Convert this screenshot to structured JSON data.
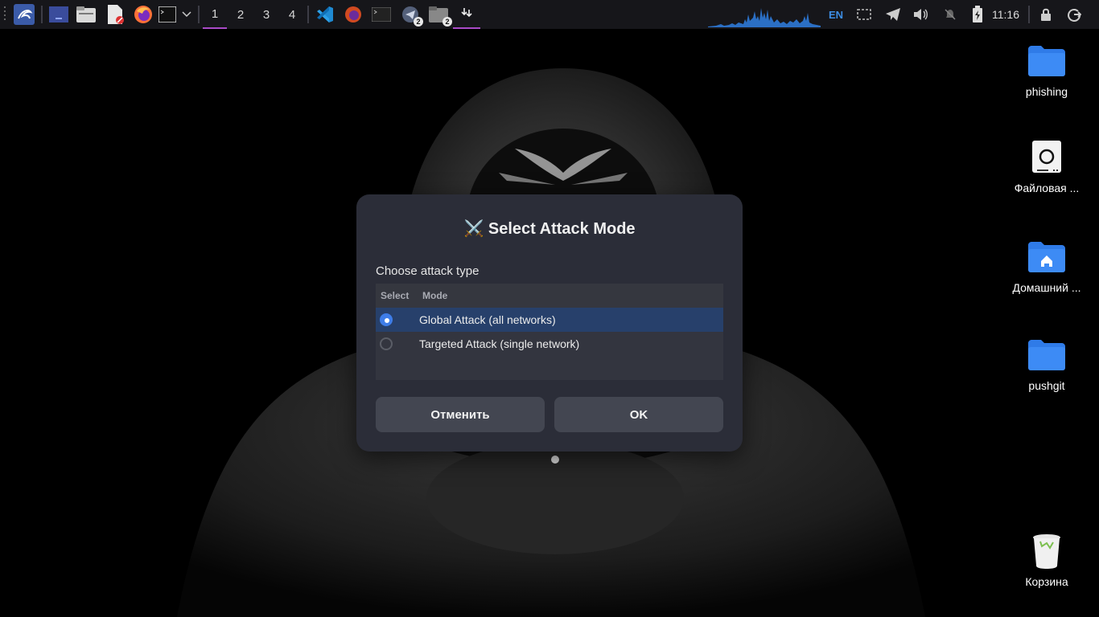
{
  "taskbar": {
    "workspaces": [
      "1",
      "2",
      "3",
      "4"
    ],
    "active_workspace": "1",
    "telegram_badge": "2",
    "files_badge": "2",
    "keyboard_layout": "EN",
    "clock": "11:16"
  },
  "desktop_icons": [
    {
      "label": "phishing",
      "icon": "folder-icon"
    },
    {
      "label": "Файловая ...",
      "icon": "drive-icon"
    },
    {
      "label": "Домашний ...",
      "icon": "home-folder-icon"
    },
    {
      "label": "pushgit",
      "icon": "folder-icon"
    },
    {
      "label": "Корзина",
      "icon": "trash-icon"
    }
  ],
  "dialog": {
    "title": "⚔️ Select Attack Mode",
    "subtitle": "Choose attack type",
    "columns": [
      "Select",
      "Mode"
    ],
    "rows": [
      {
        "mode": "Global Attack (all networks)",
        "selected": true
      },
      {
        "mode": "Targeted Attack (single network)",
        "selected": false
      }
    ],
    "cancel_label": "Отменить",
    "ok_label": "OK"
  },
  "colors": {
    "accent": "#3e7de8",
    "selected_row": "#27406b",
    "dialog_bg": "#2b2d38",
    "folder_blue": "#2f7be8",
    "workspace_indicator": "#a94bc7"
  }
}
